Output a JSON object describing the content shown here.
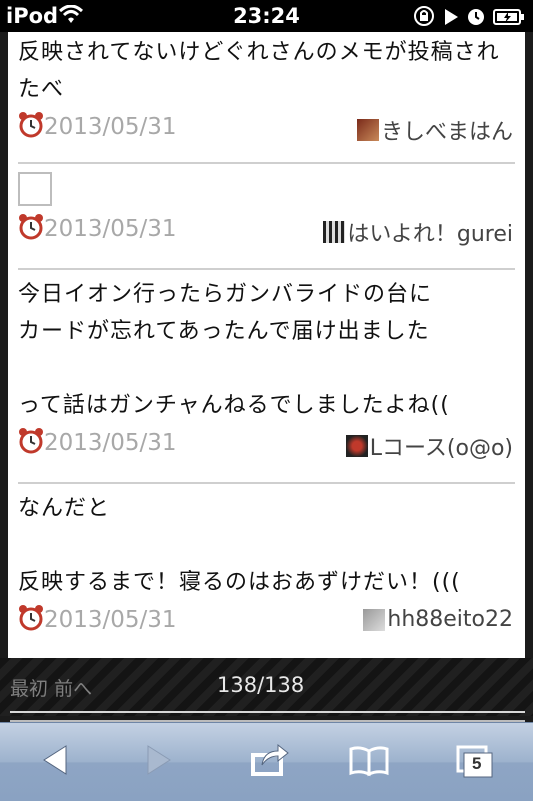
{
  "status_bar": {
    "carrier": "iPod",
    "time": "23:24"
  },
  "posts": [
    {
      "text": "反映されてないけどぐれさんのメモが投稿されたべ",
      "date": "2013/05/31",
      "author": "きしべまはん"
    },
    {
      "text": "",
      "has_image": true,
      "date": "2013/05/31",
      "author": "はいよれ！gurei"
    },
    {
      "text": "今日イオン行ったらガンバライドの台に\nカードが忘れてあったんで届け出ました\n\nって話はガンチャんねるでしましたよね((",
      "date": "2013/05/31",
      "author": "Lコース(o@o)"
    },
    {
      "text": "なんだと\n\n反映するまで！寝るのはおあずけだい！(((",
      "date": "2013/05/31",
      "author": "hh88eito22"
    }
  ],
  "pagination": {
    "first_label": "最初",
    "prev_label": "前へ",
    "count": "138/138"
  },
  "toolbar": {
    "icons": [
      "back-icon",
      "forward-icon",
      "share-icon",
      "bookmarks-icon",
      "tabs-icon"
    ],
    "tabs_count": "5"
  }
}
